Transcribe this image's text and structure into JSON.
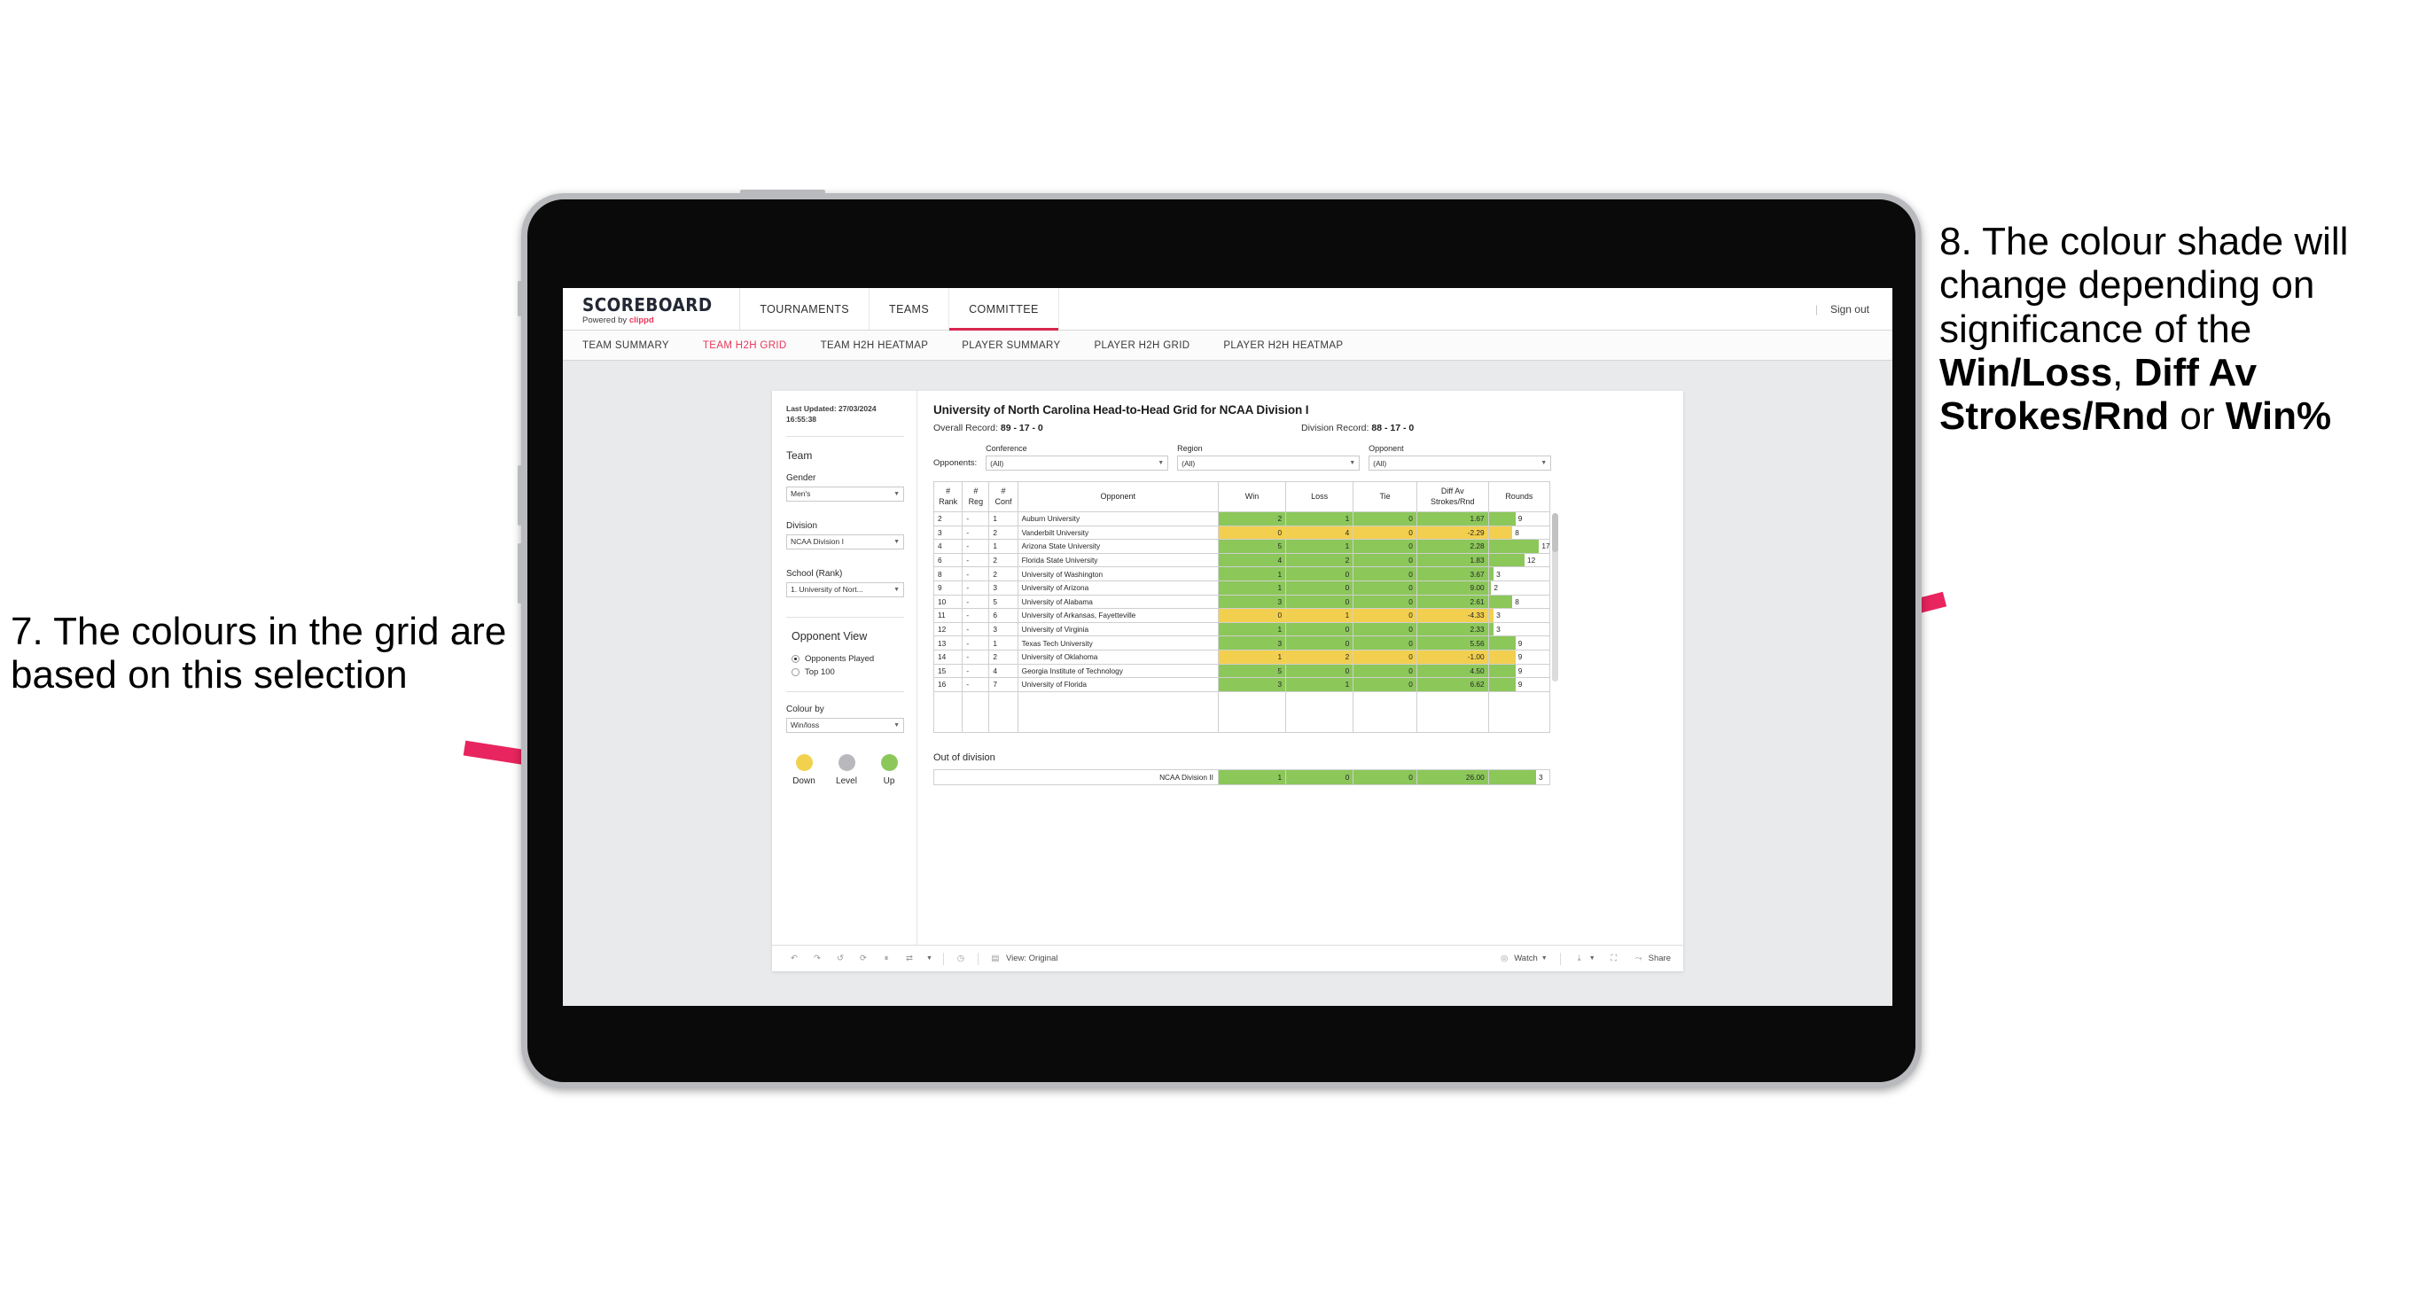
{
  "annotations": {
    "left": {
      "number": "7.",
      "text": "The colours in the grid are based on this selection"
    },
    "right": {
      "number": "8.",
      "pre": "The colour shade will change depending on significance of the ",
      "bold1": "Win/Loss",
      "mid1": ", ",
      "bold2": "Diff Av Strokes/Rnd",
      "mid2": " or ",
      "bold3": "Win%"
    },
    "arrow_color": "#e8255e"
  },
  "header": {
    "logo_word": "SCOREBOARD",
    "logo_sub_pre": "Powered by ",
    "logo_sub_brand": "clippd",
    "nav": [
      {
        "label": "TOURNAMENTS",
        "active": false
      },
      {
        "label": "TEAMS",
        "active": false
      },
      {
        "label": "COMMITTEE",
        "active": true
      }
    ],
    "separator": "|",
    "sign_out": "Sign out"
  },
  "subnav": [
    {
      "label": "TEAM SUMMARY",
      "active": false
    },
    {
      "label": "TEAM H2H GRID",
      "active": true
    },
    {
      "label": "TEAM H2H HEATMAP",
      "active": false
    },
    {
      "label": "PLAYER SUMMARY",
      "active": false
    },
    {
      "label": "PLAYER H2H GRID",
      "active": false
    },
    {
      "label": "PLAYER H2H HEATMAP",
      "active": false
    }
  ],
  "filters": {
    "last_updated": "Last Updated: 27/03/2024 16:55:38",
    "team_heading": "Team",
    "gender_label": "Gender",
    "gender_value": "Men's",
    "division_label": "Division",
    "division_value": "NCAA Division I",
    "school_label": "School (Rank)",
    "school_value": "1. University of Nort...",
    "opponent_view_heading": "Opponent View",
    "opponent_view_options": [
      {
        "label": "Opponents Played",
        "selected": true
      },
      {
        "label": "Top 100",
        "selected": false
      }
    ],
    "colour_by_label": "Colour by",
    "colour_by_value": "Win/loss",
    "legend": [
      {
        "label": "Down",
        "color": "#f2d14e"
      },
      {
        "label": "Level",
        "color": "#b9b9bd"
      },
      {
        "label": "Up",
        "color": "#8cc75a"
      }
    ]
  },
  "main": {
    "title": "University of North Carolina Head-to-Head Grid for NCAA Division I",
    "overall_record_label": "Overall Record:",
    "overall_record_value": "89 - 17 - 0",
    "division_record_label": "Division Record:",
    "division_record_value": "88 - 17 - 0",
    "opponents_label": "Opponents:",
    "opponent_filters": [
      {
        "label": "Conference",
        "value": "(All)"
      },
      {
        "label": "Region",
        "value": "(All)"
      },
      {
        "label": "Opponent",
        "value": "(All)"
      }
    ],
    "columns": [
      "# Rank",
      "# Reg",
      "# Conf",
      "Opponent",
      "Win",
      "Loss",
      "Tie",
      "Diff Av Strokes/Rnd",
      "Rounds"
    ],
    "column_lines": [
      [
        "#",
        "Rank"
      ],
      [
        "#",
        "Reg"
      ],
      [
        "#",
        "Conf"
      ],
      [
        "Opponent"
      ],
      [
        "Win"
      ],
      [
        "Loss"
      ],
      [
        "Tie"
      ],
      [
        "Diff Av",
        "Strokes/Rnd"
      ],
      [
        "Rounds"
      ]
    ],
    "rows": [
      {
        "rank": "2",
        "reg": "-",
        "conf": "1",
        "opponent": "Auburn University",
        "win": "2",
        "loss": "1",
        "tie": "0",
        "diff": "1.67",
        "rounds": "9",
        "rounds_pct": 44,
        "tone": "up"
      },
      {
        "rank": "3",
        "reg": "-",
        "conf": "2",
        "opponent": "Vanderbilt University",
        "win": "0",
        "loss": "4",
        "tie": "0",
        "diff": "-2.29",
        "rounds": "8",
        "rounds_pct": 39,
        "tone": "down"
      },
      {
        "rank": "4",
        "reg": "-",
        "conf": "1",
        "opponent": "Arizona State University",
        "win": "5",
        "loss": "1",
        "tie": "0",
        "diff": "2.28",
        "rounds": "17",
        "rounds_pct": 83,
        "tone": "up"
      },
      {
        "rank": "6",
        "reg": "-",
        "conf": "2",
        "opponent": "Florida State University",
        "win": "4",
        "loss": "2",
        "tie": "0",
        "diff": "1.83",
        "rounds": "12",
        "rounds_pct": 59,
        "tone": "up"
      },
      {
        "rank": "8",
        "reg": "-",
        "conf": "2",
        "opponent": "University of Washington",
        "win": "1",
        "loss": "0",
        "tie": "0",
        "diff": "3.67",
        "rounds": "3",
        "rounds_pct": 8,
        "tone": "up"
      },
      {
        "rank": "9",
        "reg": "-",
        "conf": "3",
        "opponent": "University of Arizona",
        "win": "1",
        "loss": "0",
        "tie": "0",
        "diff": "9.00",
        "rounds": "2",
        "rounds_pct": 4,
        "tone": "up"
      },
      {
        "rank": "10",
        "reg": "-",
        "conf": "5",
        "opponent": "University of Alabama",
        "win": "3",
        "loss": "0",
        "tie": "0",
        "diff": "2.61",
        "rounds": "8",
        "rounds_pct": 39,
        "tone": "up"
      },
      {
        "rank": "11",
        "reg": "-",
        "conf": "6",
        "opponent": "University of Arkansas, Fayetteville",
        "win": "0",
        "loss": "1",
        "tie": "0",
        "diff": "-4.33",
        "rounds": "3",
        "rounds_pct": 8,
        "tone": "down"
      },
      {
        "rank": "12",
        "reg": "-",
        "conf": "3",
        "opponent": "University of Virginia",
        "win": "1",
        "loss": "0",
        "tie": "0",
        "diff": "2.33",
        "rounds": "3",
        "rounds_pct": 8,
        "tone": "up"
      },
      {
        "rank": "13",
        "reg": "-",
        "conf": "1",
        "opponent": "Texas Tech University",
        "win": "3",
        "loss": "0",
        "tie": "0",
        "diff": "5.56",
        "rounds": "9",
        "rounds_pct": 44,
        "tone": "up"
      },
      {
        "rank": "14",
        "reg": "-",
        "conf": "2",
        "opponent": "University of Oklahoma",
        "win": "1",
        "loss": "2",
        "tie": "0",
        "diff": "-1.00",
        "rounds": "9",
        "rounds_pct": 44,
        "tone": "down"
      },
      {
        "rank": "15",
        "reg": "-",
        "conf": "4",
        "opponent": "Georgia Institute of Technology",
        "win": "5",
        "loss": "0",
        "tie": "0",
        "diff": "4.50",
        "rounds": "9",
        "rounds_pct": 44,
        "tone": "up"
      },
      {
        "rank": "16",
        "reg": "-",
        "conf": "7",
        "opponent": "University of Florida",
        "win": "3",
        "loss": "1",
        "tie": "0",
        "diff": "6.62",
        "rounds": "9",
        "rounds_pct": 44,
        "tone": "up"
      }
    ],
    "out_of_division_title": "Out of division",
    "out_of_division_row": {
      "name": "NCAA Division II",
      "win": "1",
      "loss": "0",
      "tie": "0",
      "diff": "26.00",
      "rounds": "3",
      "rounds_pct": 78,
      "tone": "up"
    }
  },
  "toolbar": {
    "icons": [
      "undo-icon",
      "redo-icon",
      "revert-icon",
      "refresh-icon",
      "pause-icon",
      "swap-icon"
    ],
    "view_label": "View: Original",
    "watch_label": "Watch",
    "share_label": "Share"
  },
  "colors": {
    "up": "#8cc75a",
    "down": "#f2cf4e",
    "level": "#b9b9bd",
    "accent": "#e8375a",
    "rounds_bar_up": "#8cc75a",
    "rounds_bar_down": "#f2cf4e"
  }
}
